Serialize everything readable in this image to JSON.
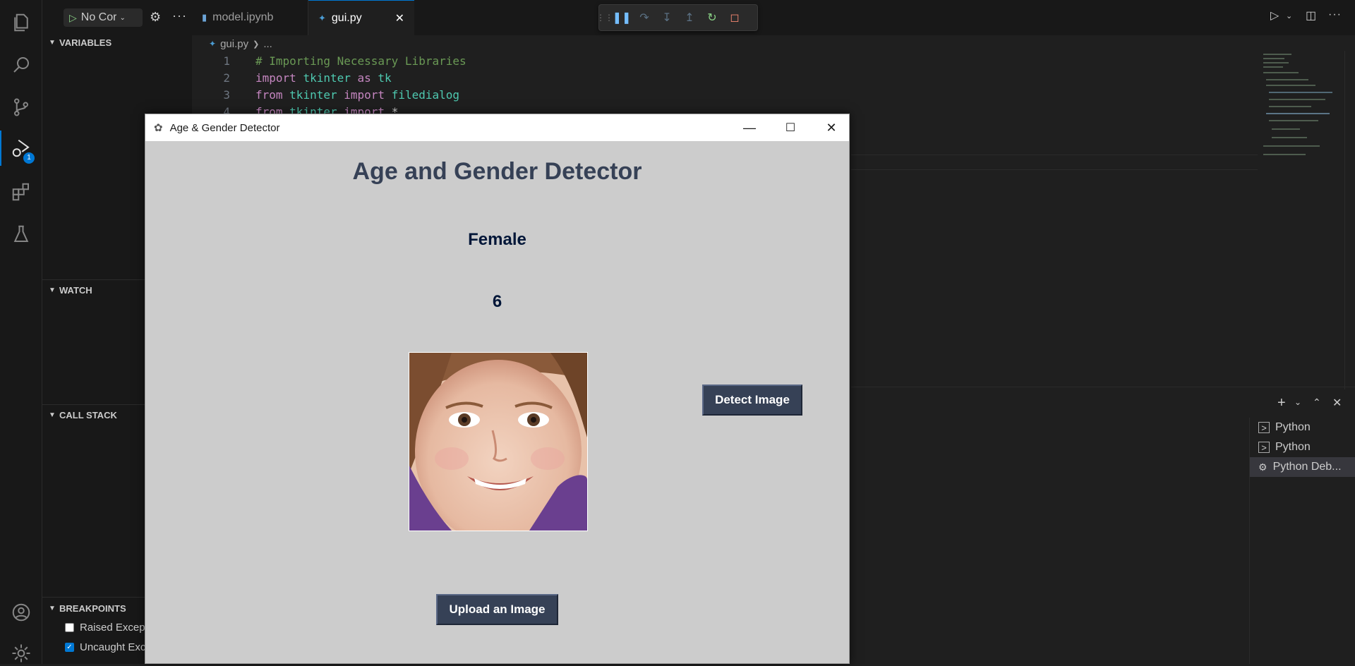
{
  "toolbar": {
    "run_config": "No Cor"
  },
  "tabs": [
    {
      "label": "model.ipynb"
    },
    {
      "label": "gui.py"
    }
  ],
  "activity": {
    "debug_badge": "1"
  },
  "sidebar": {
    "variables": "VARIABLES",
    "watch": "WATCH",
    "callstack": "CALL STACK",
    "breakpoints": {
      "title": "BREAKPOINTS",
      "items": [
        {
          "label": "Raised Exceptions",
          "checked": false
        },
        {
          "label": "Uncaught Exceptions",
          "checked": true
        }
      ]
    }
  },
  "breadcrumb": {
    "file": "gui.py",
    "rest": "..."
  },
  "code": [
    {
      "n": "1",
      "comment": "# Importing Necessary Libraries"
    },
    {
      "n": "2",
      "a": "import",
      "b": "tkinter",
      "c": "as",
      "d": "tk"
    },
    {
      "n": "3",
      "a": "from",
      "b": "tkinter",
      "c": "import",
      "d": "filedialog"
    },
    {
      "n": "4",
      "a": "from",
      "b": "tkinter",
      "c": "import",
      "d": "*"
    }
  ],
  "panel": {
    "terminals": [
      {
        "label": "Python"
      },
      {
        "label": "Python"
      },
      {
        "label": "Python Deb..."
      }
    ]
  },
  "app": {
    "window_title": "Age & Gender Detector",
    "heading": "Age and Gender Detector",
    "gender": "Female",
    "age": "6",
    "detect_button": "Detect Image",
    "upload_button": "Upload an Image"
  }
}
